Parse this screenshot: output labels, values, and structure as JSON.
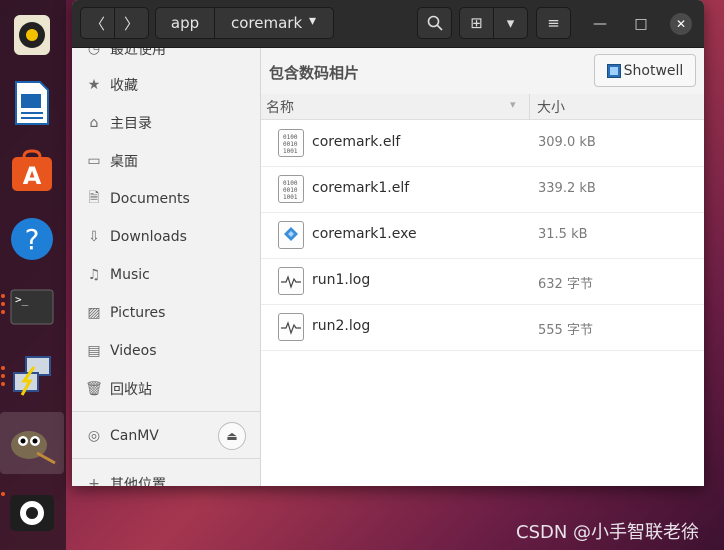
{
  "dock": {
    "items": [
      {
        "name": "rhythmbox-icon"
      },
      {
        "name": "libreoffice-writer-icon"
      },
      {
        "name": "software-center-icon"
      },
      {
        "name": "help-icon",
        "glyph": "?"
      },
      {
        "name": "terminal-icon",
        "glyph": ">_"
      },
      {
        "name": "network-connections-icon"
      },
      {
        "name": "gimp-icon"
      },
      {
        "name": "camera-icon"
      }
    ]
  },
  "header": {
    "back_glyph": "〈",
    "forward_glyph": "〉",
    "crumbs": [
      "app",
      "coremark"
    ],
    "crumb_dropdown": "▾",
    "search_glyph": "🔍",
    "view_glyph": "⊞",
    "view_dropdown": "▾",
    "menu_glyph": "≡",
    "minimize": "—",
    "maximize": "□",
    "close": "✕"
  },
  "sidebar": {
    "partial_top": "最近使用",
    "items": [
      {
        "label": "收藏",
        "glyph": "★"
      },
      {
        "label": "主目录",
        "glyph": "⌂"
      },
      {
        "label": "桌面",
        "glyph": "▭"
      },
      {
        "label": "Documents",
        "glyph": "🗎"
      },
      {
        "label": "Downloads",
        "glyph": "⇩"
      },
      {
        "label": "Music",
        "glyph": "♫"
      },
      {
        "label": "Pictures",
        "glyph": "▨"
      },
      {
        "label": "Videos",
        "glyph": "▤"
      },
      {
        "label": "回收站",
        "glyph": "🗑"
      }
    ],
    "device": {
      "label": "CanMV",
      "glyph": "◎",
      "eject": "⏏"
    },
    "partial_bottom": {
      "label": "其他位置",
      "glyph": "+"
    }
  },
  "main": {
    "hint": "包含数码相片",
    "open_button": "Shotwell",
    "columns": {
      "name": "名称",
      "size": "大小",
      "sort_glyph": "▾"
    },
    "files": [
      {
        "name": "coremark.elf",
        "size": "309.0 kB",
        "icon": "binary-file-icon"
      },
      {
        "name": "coremark1.elf",
        "size": "339.2 kB",
        "icon": "binary-file-icon"
      },
      {
        "name": "coremark1.exe",
        "size": "31.5 kB",
        "icon": "executable-file-icon"
      },
      {
        "name": "run1.log",
        "size": "632 字节",
        "icon": "log-file-icon"
      },
      {
        "name": "run2.log",
        "size": "555 字节",
        "icon": "log-file-icon"
      }
    ]
  },
  "watermark": "CSDN @小手智联老徐"
}
